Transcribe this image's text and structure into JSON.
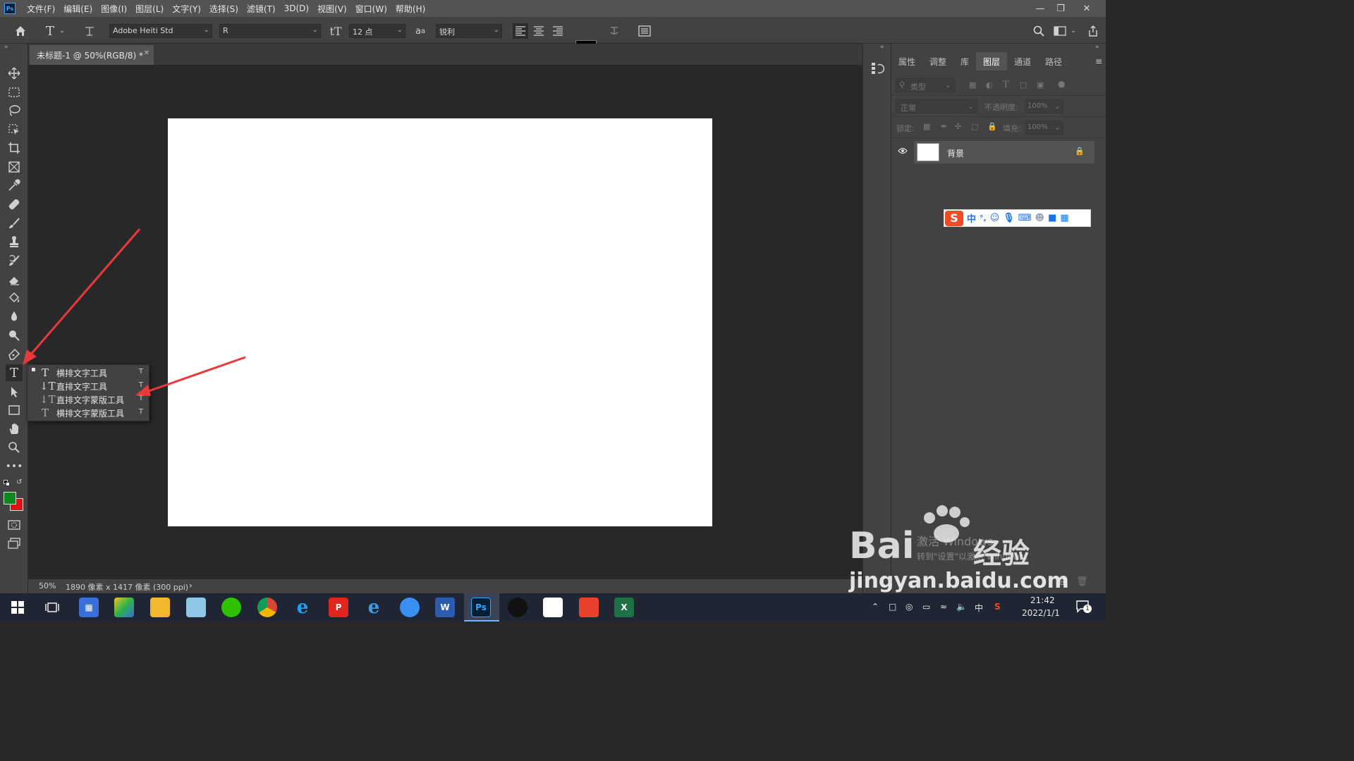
{
  "menubar": {
    "app_icon": "Ps",
    "items": [
      "文件(F)",
      "编辑(E)",
      "图像(I)",
      "图层(L)",
      "文字(Y)",
      "选择(S)",
      "滤镜(T)",
      "3D(D)",
      "视图(V)",
      "窗口(W)",
      "帮助(H)"
    ],
    "window_controls": [
      "minimize-icon",
      "restore-icon",
      "close-icon"
    ]
  },
  "options": {
    "font_family": "Adobe Heiti Std",
    "font_style": "R",
    "font_size": "12 点",
    "aa_label": "a",
    "antialias": "锐利",
    "text_color": "#000000"
  },
  "document": {
    "tab_title": "未标题-1 @ 50%(RGB/8) *",
    "canvas_color": "#ffffff"
  },
  "status": {
    "zoom": "50%",
    "info": "1890 像素 x 1417 像素 (300 ppi)",
    "arrow": "›"
  },
  "toolbar": {
    "foreground": "#0a8a1e",
    "background": "#e01010",
    "tools": [
      "move-icon",
      "marquee-icon",
      "lasso-icon",
      "object-select-icon",
      "crop-icon",
      "frame-icon",
      "eyedropper-icon",
      "healing-icon",
      "brush-icon",
      "stamp-icon",
      "history-brush-icon",
      "eraser-icon",
      "paint-bucket-icon",
      "blur-icon",
      "dodge-icon",
      "pen-icon",
      "type-icon",
      "path-select-icon",
      "rectangle-icon",
      "hand-icon",
      "zoom-icon",
      "more-icon"
    ]
  },
  "flyout": {
    "items": [
      {
        "label": "横排文字工具",
        "key": "T",
        "icon": "horizontal-type-icon",
        "active": true
      },
      {
        "label": "直排文字工具",
        "key": "T",
        "icon": "vertical-type-icon",
        "active": false
      },
      {
        "label": "直排文字蒙版工具",
        "key": "T",
        "icon": "vertical-type-mask-icon",
        "active": false
      },
      {
        "label": "横排文字蒙版工具",
        "key": "T",
        "icon": "horizontal-type-mask-icon",
        "active": false
      }
    ]
  },
  "panel": {
    "tabs": [
      "属性",
      "调整",
      "库",
      "图层",
      "通道",
      "路径"
    ],
    "active_tab": "图层",
    "filter_placeholder": "类型",
    "blend_mode": "正常",
    "opacity_label": "不透明度:",
    "opacity_value": "100%",
    "lock_label": "锁定:",
    "fill_label": "填充:",
    "fill_value": "100%",
    "layer_name": "背景"
  },
  "ime": {
    "chars": [
      "中",
      "°,"
    ]
  },
  "watermark": {
    "brand": "Bai",
    "brand2": "经验",
    "url": "jingyan.baidu.com",
    "activate_line1": "激活 Windows",
    "activate_line2": "转到\"设置\"以激活 Windows。"
  },
  "taskbar": {
    "apps": [
      "start-icon",
      "task-view-icon",
      "app-grid-icon",
      "paint-app-icon",
      "file-explorer-icon",
      "notepad-app-icon",
      "wechat-icon",
      "chrome-icon",
      "ie-icon",
      "wps-pdf-icon",
      "edge-icon",
      "feishu-icon",
      "word-icon",
      "photoshop-icon",
      "qq-icon",
      "baidu-netdisk-icon",
      "xmind-icon",
      "excel-icon"
    ],
    "ps_label": "Ps",
    "word_label": "W",
    "excel_label": "X",
    "time": "21:42",
    "date": "2022/1/1",
    "ime_label": "中",
    "notification_count": "1"
  }
}
